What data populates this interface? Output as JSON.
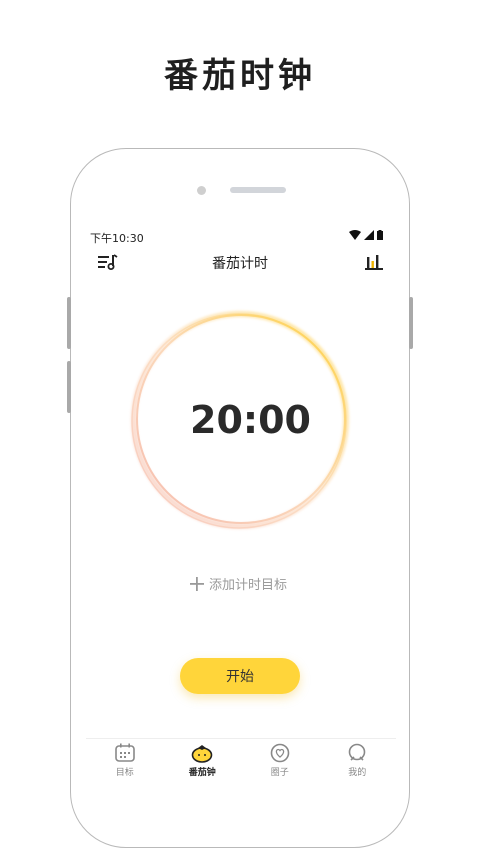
{
  "headline": "番茄时钟",
  "status_bar": {
    "time": "下午10:30"
  },
  "header": {
    "title": "番茄计时"
  },
  "timer": {
    "display": "20:00"
  },
  "add_goal": {
    "label": "添加计时目标"
  },
  "start_button": {
    "label": "开始"
  },
  "tabs": [
    {
      "label": "目标",
      "icon": "calendar-icon",
      "active": false
    },
    {
      "label": "番茄钟",
      "icon": "tomato-icon",
      "active": true
    },
    {
      "label": "圈子",
      "icon": "heart-chat-icon",
      "active": false
    },
    {
      "label": "我的",
      "icon": "profile-icon",
      "active": false
    }
  ],
  "colors": {
    "accent": "#ffd53a",
    "ring_start": "#f6b8a6",
    "ring_end": "#ffd23a"
  }
}
